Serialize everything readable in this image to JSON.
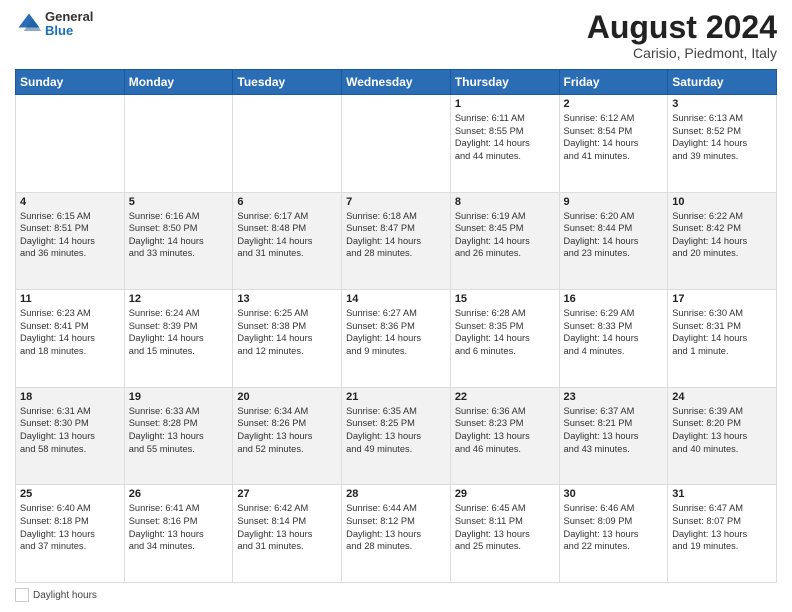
{
  "header": {
    "logo_general": "General",
    "logo_blue": "Blue",
    "month_year": "August 2024",
    "location": "Carisio, Piedmont, Italy"
  },
  "days_of_week": [
    "Sunday",
    "Monday",
    "Tuesday",
    "Wednesday",
    "Thursday",
    "Friday",
    "Saturday"
  ],
  "weeks": [
    [
      {
        "day": "",
        "content": ""
      },
      {
        "day": "",
        "content": ""
      },
      {
        "day": "",
        "content": ""
      },
      {
        "day": "",
        "content": ""
      },
      {
        "day": "1",
        "content": "Sunrise: 6:11 AM\nSunset: 8:55 PM\nDaylight: 14 hours\nand 44 minutes."
      },
      {
        "day": "2",
        "content": "Sunrise: 6:12 AM\nSunset: 8:54 PM\nDaylight: 14 hours\nand 41 minutes."
      },
      {
        "day": "3",
        "content": "Sunrise: 6:13 AM\nSunset: 8:52 PM\nDaylight: 14 hours\nand 39 minutes."
      }
    ],
    [
      {
        "day": "4",
        "content": "Sunrise: 6:15 AM\nSunset: 8:51 PM\nDaylight: 14 hours\nand 36 minutes."
      },
      {
        "day": "5",
        "content": "Sunrise: 6:16 AM\nSunset: 8:50 PM\nDaylight: 14 hours\nand 33 minutes."
      },
      {
        "day": "6",
        "content": "Sunrise: 6:17 AM\nSunset: 8:48 PM\nDaylight: 14 hours\nand 31 minutes."
      },
      {
        "day": "7",
        "content": "Sunrise: 6:18 AM\nSunset: 8:47 PM\nDaylight: 14 hours\nand 28 minutes."
      },
      {
        "day": "8",
        "content": "Sunrise: 6:19 AM\nSunset: 8:45 PM\nDaylight: 14 hours\nand 26 minutes."
      },
      {
        "day": "9",
        "content": "Sunrise: 6:20 AM\nSunset: 8:44 PM\nDaylight: 14 hours\nand 23 minutes."
      },
      {
        "day": "10",
        "content": "Sunrise: 6:22 AM\nSunset: 8:42 PM\nDaylight: 14 hours\nand 20 minutes."
      }
    ],
    [
      {
        "day": "11",
        "content": "Sunrise: 6:23 AM\nSunset: 8:41 PM\nDaylight: 14 hours\nand 18 minutes."
      },
      {
        "day": "12",
        "content": "Sunrise: 6:24 AM\nSunset: 8:39 PM\nDaylight: 14 hours\nand 15 minutes."
      },
      {
        "day": "13",
        "content": "Sunrise: 6:25 AM\nSunset: 8:38 PM\nDaylight: 14 hours\nand 12 minutes."
      },
      {
        "day": "14",
        "content": "Sunrise: 6:27 AM\nSunset: 8:36 PM\nDaylight: 14 hours\nand 9 minutes."
      },
      {
        "day": "15",
        "content": "Sunrise: 6:28 AM\nSunset: 8:35 PM\nDaylight: 14 hours\nand 6 minutes."
      },
      {
        "day": "16",
        "content": "Sunrise: 6:29 AM\nSunset: 8:33 PM\nDaylight: 14 hours\nand 4 minutes."
      },
      {
        "day": "17",
        "content": "Sunrise: 6:30 AM\nSunset: 8:31 PM\nDaylight: 14 hours\nand 1 minute."
      }
    ],
    [
      {
        "day": "18",
        "content": "Sunrise: 6:31 AM\nSunset: 8:30 PM\nDaylight: 13 hours\nand 58 minutes."
      },
      {
        "day": "19",
        "content": "Sunrise: 6:33 AM\nSunset: 8:28 PM\nDaylight: 13 hours\nand 55 minutes."
      },
      {
        "day": "20",
        "content": "Sunrise: 6:34 AM\nSunset: 8:26 PM\nDaylight: 13 hours\nand 52 minutes."
      },
      {
        "day": "21",
        "content": "Sunrise: 6:35 AM\nSunset: 8:25 PM\nDaylight: 13 hours\nand 49 minutes."
      },
      {
        "day": "22",
        "content": "Sunrise: 6:36 AM\nSunset: 8:23 PM\nDaylight: 13 hours\nand 46 minutes."
      },
      {
        "day": "23",
        "content": "Sunrise: 6:37 AM\nSunset: 8:21 PM\nDaylight: 13 hours\nand 43 minutes."
      },
      {
        "day": "24",
        "content": "Sunrise: 6:39 AM\nSunset: 8:20 PM\nDaylight: 13 hours\nand 40 minutes."
      }
    ],
    [
      {
        "day": "25",
        "content": "Sunrise: 6:40 AM\nSunset: 8:18 PM\nDaylight: 13 hours\nand 37 minutes."
      },
      {
        "day": "26",
        "content": "Sunrise: 6:41 AM\nSunset: 8:16 PM\nDaylight: 13 hours\nand 34 minutes."
      },
      {
        "day": "27",
        "content": "Sunrise: 6:42 AM\nSunset: 8:14 PM\nDaylight: 13 hours\nand 31 minutes."
      },
      {
        "day": "28",
        "content": "Sunrise: 6:44 AM\nSunset: 8:12 PM\nDaylight: 13 hours\nand 28 minutes."
      },
      {
        "day": "29",
        "content": "Sunrise: 6:45 AM\nSunset: 8:11 PM\nDaylight: 13 hours\nand 25 minutes."
      },
      {
        "day": "30",
        "content": "Sunrise: 6:46 AM\nSunset: 8:09 PM\nDaylight: 13 hours\nand 22 minutes."
      },
      {
        "day": "31",
        "content": "Sunrise: 6:47 AM\nSunset: 8:07 PM\nDaylight: 13 hours\nand 19 minutes."
      }
    ]
  ],
  "legend": {
    "daylight_label": "Daylight hours"
  }
}
